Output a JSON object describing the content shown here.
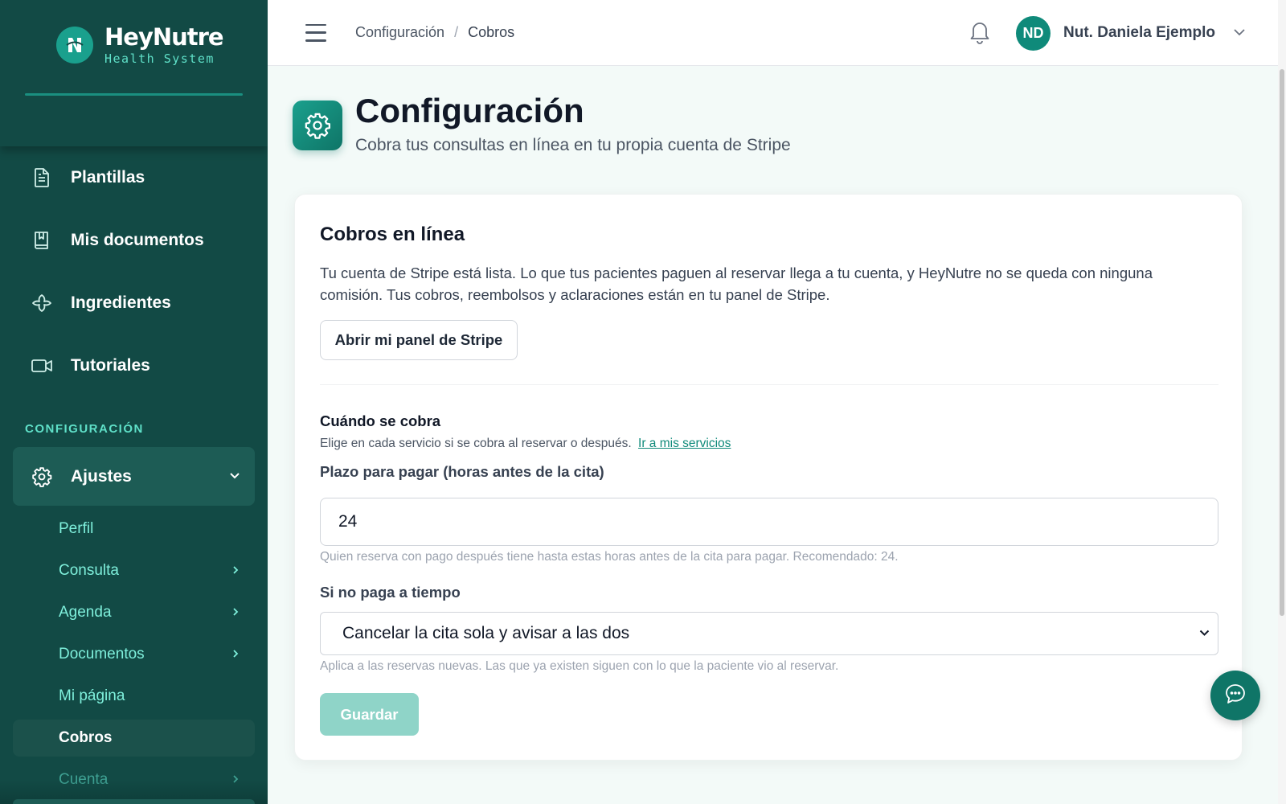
{
  "brand": {
    "name": "HeyNutre",
    "tagline": "Health System"
  },
  "sidebar": {
    "items": [
      {
        "label": "Plantillas",
        "icon": "document-icon"
      },
      {
        "label": "Mis documentos",
        "icon": "book-icon"
      },
      {
        "label": "Ingredientes",
        "icon": "ingredient-icon"
      },
      {
        "label": "Tutoriales",
        "icon": "video-icon"
      }
    ],
    "section_label": "CONFIGURACIÓN",
    "ajustes_label": "Ajustes",
    "sub_items": [
      {
        "label": "Perfil",
        "has_chevron": false
      },
      {
        "label": "Consulta",
        "has_chevron": true
      },
      {
        "label": "Agenda",
        "has_chevron": true
      },
      {
        "label": "Documentos",
        "has_chevron": true
      },
      {
        "label": "Mi página",
        "has_chevron": false
      },
      {
        "label": "Cobros",
        "has_chevron": false,
        "active": true
      },
      {
        "label": "Cuenta",
        "has_chevron": true
      }
    ]
  },
  "topbar": {
    "breadcrumb": [
      "Configuración",
      "Cobros"
    ],
    "breadcrumb_sep": "/",
    "avatar_initials": "ND",
    "user_name": "Nut. Daniela Ejemplo"
  },
  "page": {
    "title": "Configuración",
    "subtitle": "Cobra tus consultas en línea en tu propia cuenta de Stripe"
  },
  "card": {
    "title": "Cobros en línea",
    "description": "Tu cuenta de Stripe está lista. Lo que tus pacientes paguen al reservar llega a tu cuenta, y HeyNutre no se queda con ninguna comisión. Tus cobros, reembolsos y aclaraciones están en tu panel de Stripe.",
    "stripe_button": "Abrir mi panel de Stripe",
    "when_title": "Cuándo se cobra",
    "when_desc": "Elige en cada servicio si se cobra al reservar o después.",
    "when_link": "Ir a mis servicios",
    "hours_label": "Plazo para pagar (horas antes de la cita)",
    "hours_value": "24",
    "hours_help": "Quien reserva con pago después tiene hasta estas horas antes de la cita para pagar. Recomendado: 24.",
    "late_label": "Si no paga a tiempo",
    "late_value": "Cancelar la cita sola y avisar a las dos",
    "late_help": "Aplica a las reservas nuevas. Las que ya existen siguen con lo que la paciente vio al reservar.",
    "save_button": "Guardar"
  },
  "colors": {
    "sidebar_bg": "#124a45",
    "accent": "#0f8a7a",
    "accent_light": "#5fe0c8",
    "save_disabled": "#8fd4c8"
  }
}
